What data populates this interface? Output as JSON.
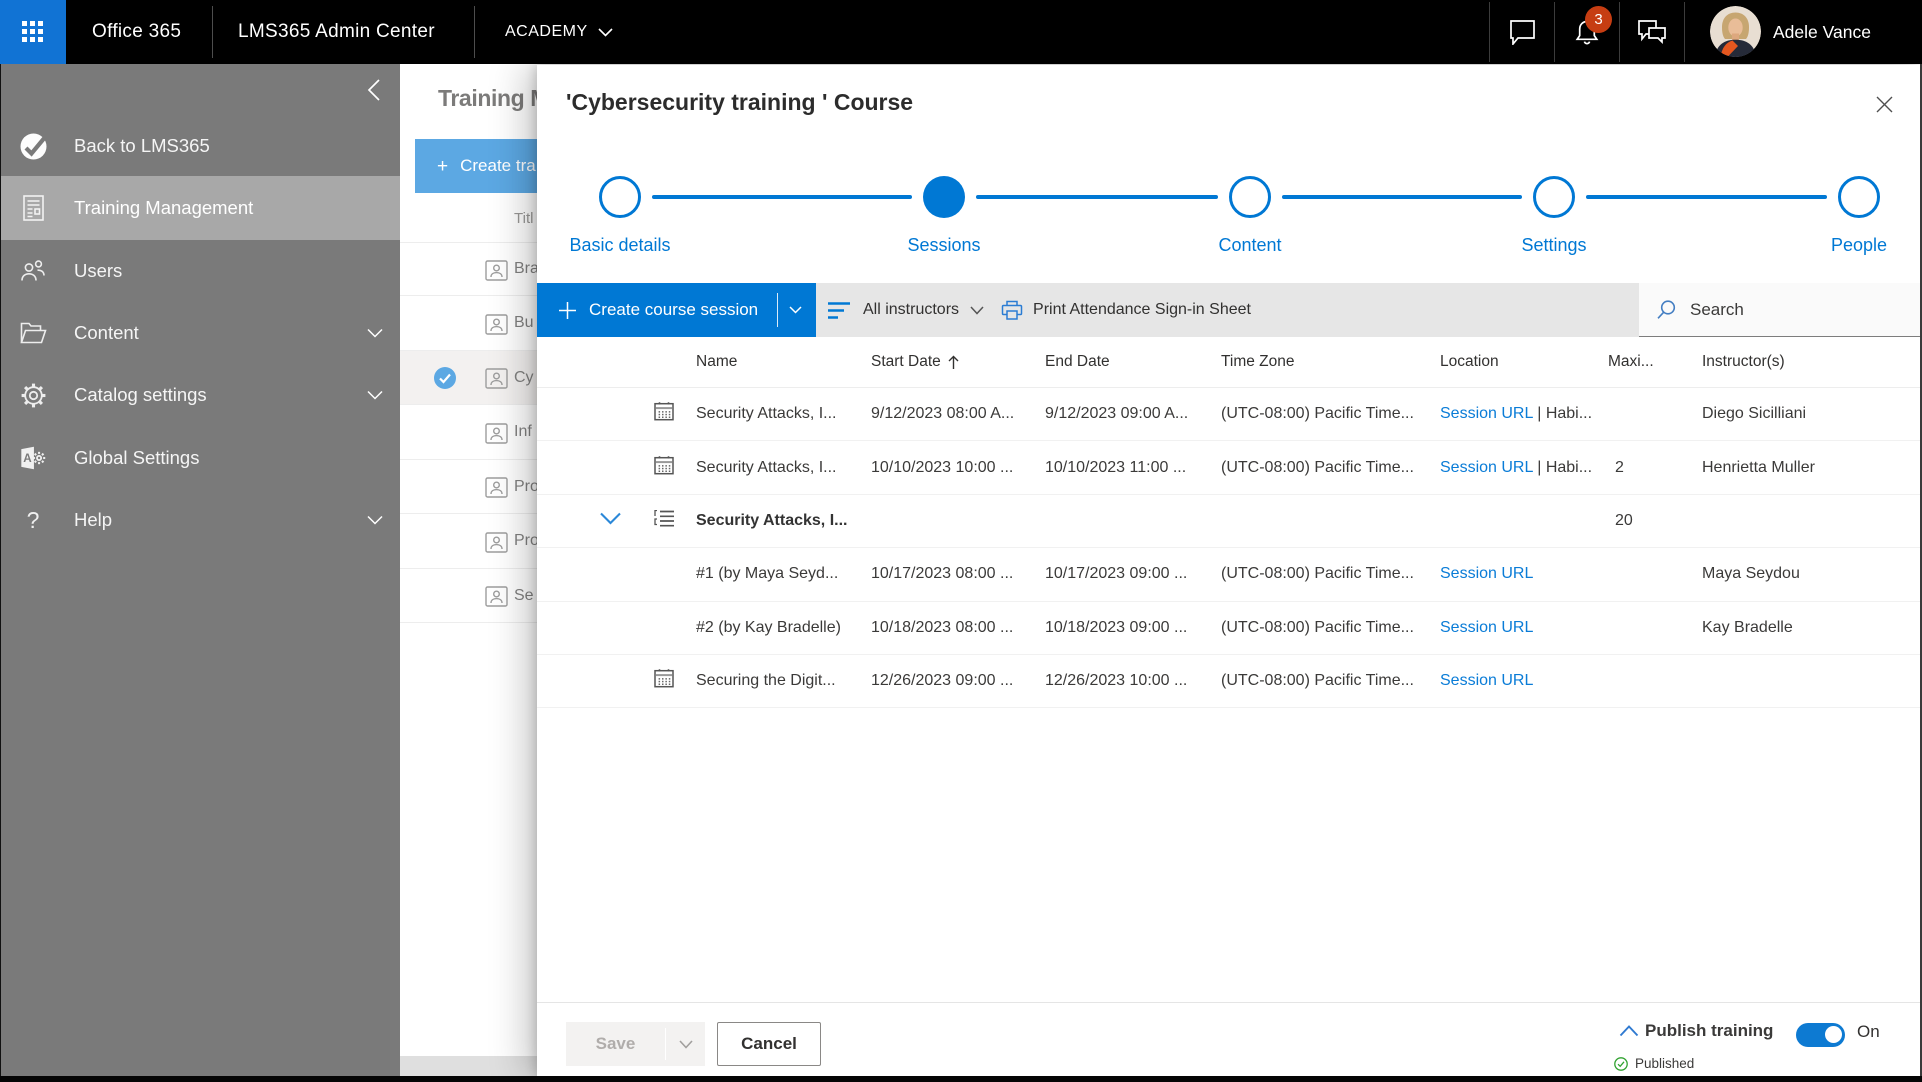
{
  "topbar": {
    "brand": "Office 365",
    "app_title": "LMS365 Admin Center",
    "tenant": "ACADEMY",
    "notification_count": "3",
    "user_name": "Adele Vance"
  },
  "sidebar": {
    "items": [
      {
        "label": "Back to LMS365",
        "icon": "lms365-logo-icon",
        "selected": false,
        "chevron": false
      },
      {
        "label": "Training Management",
        "icon": "training-doc-icon",
        "selected": true,
        "chevron": false
      },
      {
        "label": "Users",
        "icon": "users-icon",
        "selected": false,
        "chevron": false
      },
      {
        "label": "Content",
        "icon": "folder-icon",
        "selected": false,
        "chevron": true
      },
      {
        "label": "Catalog settings",
        "icon": "gear-icon",
        "selected": false,
        "chevron": true
      },
      {
        "label": "Global Settings",
        "icon": "admin-a-icon",
        "selected": false,
        "chevron": false
      },
      {
        "label": "Help",
        "icon": "question-icon",
        "selected": false,
        "chevron": true
      }
    ]
  },
  "background_page": {
    "title": "Training M",
    "create_button": "Create tra",
    "column_title": "Titl",
    "rows": [
      "Bra",
      "Bu",
      "Cy",
      "Inf",
      "Pro",
      "Pro",
      "Se"
    ],
    "selected_row_index": 2
  },
  "dialog": {
    "title": "'Cybersecurity training ' Course",
    "steps": [
      {
        "label": "Basic details",
        "state": "outline"
      },
      {
        "label": "Sessions",
        "state": "filled"
      },
      {
        "label": "Content",
        "state": "outline"
      },
      {
        "label": "Settings",
        "state": "outline"
      },
      {
        "label": "People",
        "state": "outline"
      }
    ],
    "toolbar": {
      "create_session_label": "Create course session",
      "filter_label": "All instructors",
      "print_label": "Print Attendance Sign-in Sheet",
      "search_placeholder": "Search"
    },
    "table": {
      "columns": [
        "Name",
        "Start Date",
        "End Date",
        "Time Zone",
        "Location",
        "Maxi...",
        "Instructor(s)"
      ],
      "sorted_column": "Start Date",
      "rows": [
        {
          "icon": "calendar",
          "expand": false,
          "bold": false,
          "name": "Security Attacks, I...",
          "start": "9/12/2023 08:00 A...",
          "end": "9/12/2023 09:00 A...",
          "tz": "(UTC-08:00) Pacific Time...",
          "loc_link": "Session URL",
          "loc_extra": " | Habi...",
          "max": "",
          "instructor": "Diego Sicilliani"
        },
        {
          "icon": "calendar",
          "expand": false,
          "bold": false,
          "name": "Security Attacks, I...",
          "start": "10/10/2023 10:00 ...",
          "end": "10/10/2023 11:00 ...",
          "tz": "(UTC-08:00) Pacific Time...",
          "loc_link": "Session URL",
          "loc_extra": " | Habi...",
          "max": "2",
          "instructor": "Henrietta Muller"
        },
        {
          "icon": "list",
          "expand": true,
          "bold": true,
          "name": "Security Attacks, I...",
          "start": "",
          "end": "",
          "tz": "",
          "loc_link": "",
          "loc_extra": "",
          "max": "20",
          "instructor": ""
        },
        {
          "icon": "none",
          "expand": false,
          "bold": false,
          "name": "#1 (by Maya Seyd...",
          "start": "10/17/2023 08:00 ...",
          "end": "10/17/2023 09:00 ...",
          "tz": "(UTC-08:00) Pacific Time...",
          "loc_link": "Session URL",
          "loc_extra": "",
          "max": "",
          "instructor": "Maya Seydou"
        },
        {
          "icon": "none",
          "expand": false,
          "bold": false,
          "name": "#2 (by Kay Bradelle)",
          "start": "10/18/2023 08:00 ...",
          "end": "10/18/2023 09:00 ...",
          "tz": "(UTC-08:00) Pacific Time...",
          "loc_link": "Session URL",
          "loc_extra": "",
          "max": "",
          "instructor": "Kay Bradelle"
        },
        {
          "icon": "calendar",
          "expand": false,
          "bold": false,
          "name": "Securing the Digit...",
          "start": "12/26/2023 09:00 ...",
          "end": "12/26/2023 10:00 ...",
          "tz": "(UTC-08:00) Pacific Time...",
          "loc_link": "Session URL",
          "loc_extra": "",
          "max": "",
          "instructor": ""
        }
      ]
    },
    "footer": {
      "save_label": "Save",
      "cancel_label": "Cancel",
      "publish_label": "Publish training",
      "toggle_state": "On",
      "status": "Published"
    }
  }
}
